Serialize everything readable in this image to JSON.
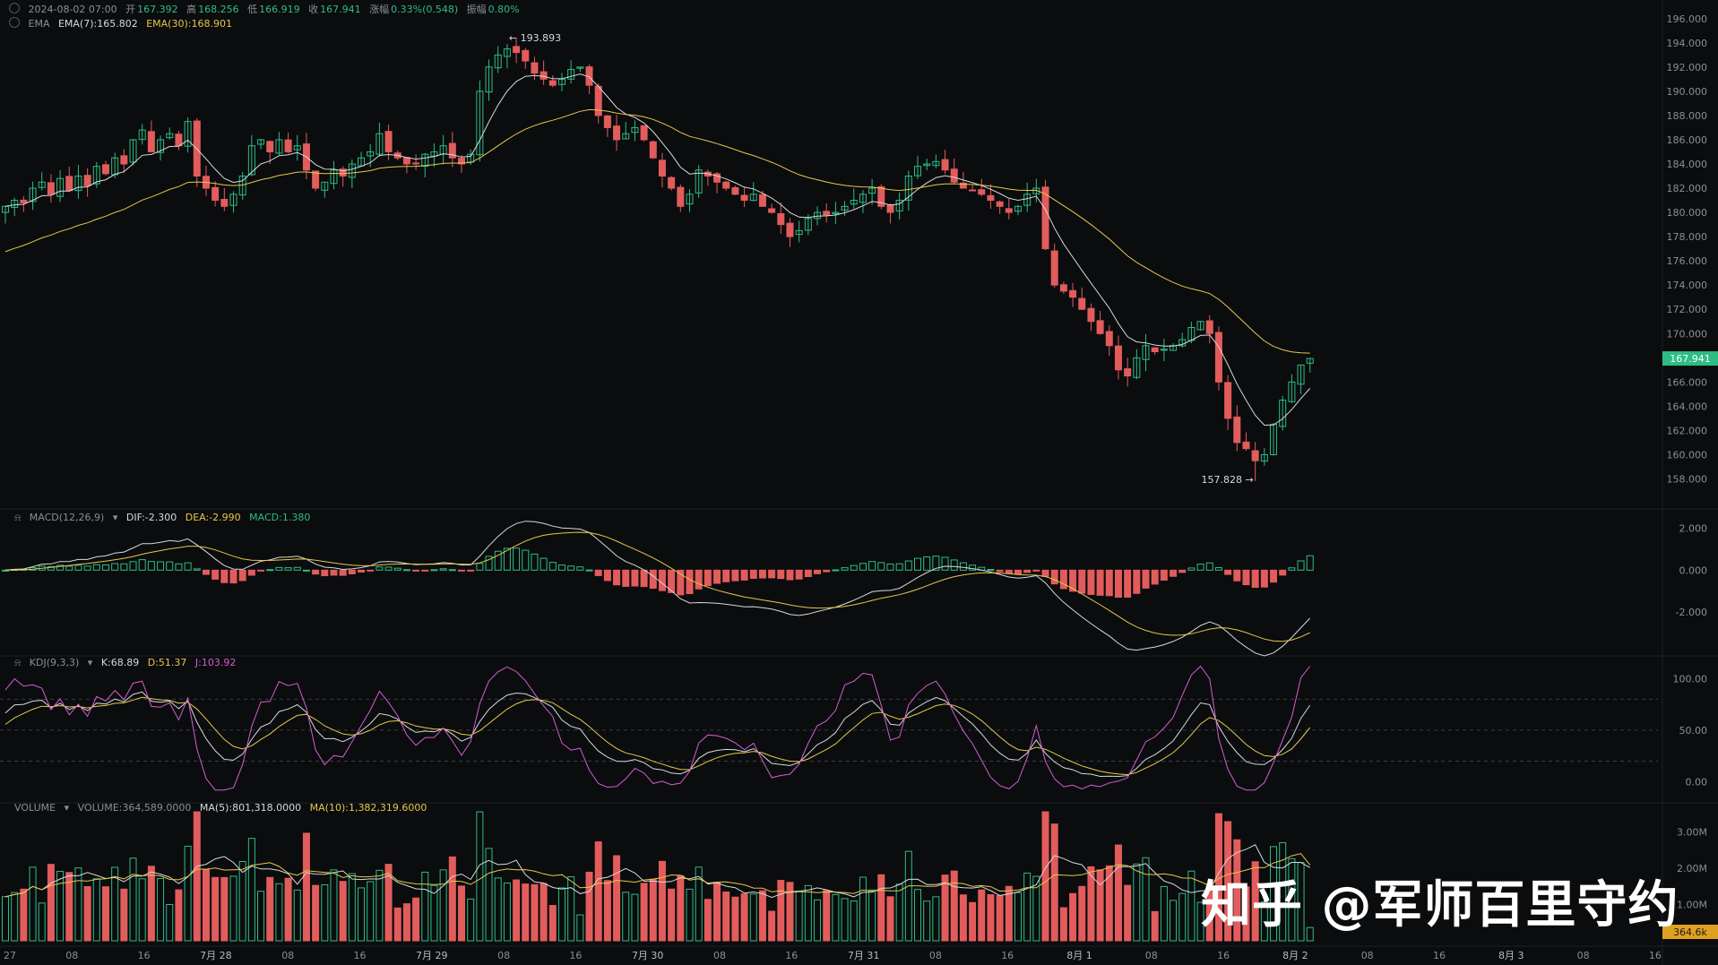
{
  "header": {
    "datetime": "2024-08-02 07:00",
    "open_label": "开",
    "open": "167.392",
    "high_label": "高",
    "high": "168.256",
    "low_label": "低",
    "low": "166.919",
    "close_label": "收",
    "close": "167.941",
    "change_label": "涨幅",
    "change": "0.33%(0.548)",
    "amp_label": "振幅",
    "amp": "0.80%"
  },
  "ema_row": {
    "name": "EMA",
    "ema7": "EMA(7):165.802",
    "ema30": "EMA(30):168.901"
  },
  "macd_row": {
    "name": "MACD(12,26,9)",
    "dif": "DIF:-2.300",
    "dea": "DEA:-2.990",
    "macd": "MACD:1.380"
  },
  "kdj_row": {
    "name": "KDJ(9,3,3)",
    "k": "K:68.89",
    "d": "D:51.37",
    "j": "J:103.92"
  },
  "vol_row": {
    "name": "VOLUME",
    "vol": "VOLUME:364,589.0000",
    "ma5": "MA(5):801,318.0000",
    "ma10": "MA(10):1,382,319.6000"
  },
  "watermark": "知乎 @军师百里守约",
  "colors": {
    "up": "#2dbd85",
    "down": "#e25c5c",
    "ema7": "#d7d9dc",
    "ema30": "#e6c84a",
    "kdj_j": "#d35ed1",
    "bg": "#0b0c0e"
  },
  "chart_data": [
    {
      "type": "candlestick",
      "title": "",
      "price_axis_ticks": [
        "196.000",
        "194.000",
        "192.000",
        "190.000",
        "188.000",
        "186.000",
        "184.000",
        "182.000",
        "180.000",
        "178.000",
        "176.000",
        "174.000",
        "172.000",
        "170.000",
        "168.000",
        "166.000",
        "164.000",
        "162.000",
        "160.000",
        "158.000"
      ],
      "ylim": [
        157,
        196.5
      ],
      "time_axis_labels": [
        "27",
        "08",
        "16",
        "7月 28",
        "08",
        "16",
        "7月 29",
        "08",
        "16",
        "7月 30",
        "08",
        "16",
        "7月 31",
        "08",
        "16",
        "8月 1",
        "08",
        "16",
        "8月 2",
        "08",
        "16",
        "8月 3",
        "08",
        "16"
      ],
      "last_price_label": "167.941",
      "annotations": {
        "high": "193.893",
        "low": "157.828"
      },
      "close_series": [
        180.5,
        181.0,
        180.8,
        182.0,
        182.5,
        181.5,
        182.8,
        181.8,
        183.0,
        182.2,
        183.8,
        183.2,
        184.5,
        184.0,
        186.0,
        186.8,
        185.0,
        186.0,
        186.5,
        185.5,
        187.5,
        183.0,
        182.0,
        181.0,
        180.5,
        181.5,
        183.0,
        185.5,
        186.0,
        185.0,
        186.0,
        185.0,
        185.5,
        183.5,
        182.0,
        182.5,
        183.5,
        183.0,
        184.0,
        184.5,
        185.0,
        186.5,
        185.0,
        184.5,
        184.0,
        184.0,
        184.8,
        185.0,
        185.5,
        184.5,
        184.0,
        184.8,
        190.0,
        192.0,
        193.0,
        193.5,
        193.2,
        192.5,
        191.5,
        191.0,
        190.5,
        191.0,
        191.8,
        192.0,
        190.5,
        188.0,
        187.0,
        186.0,
        186.5,
        187.0,
        186.0,
        184.5,
        183.0,
        182.0,
        180.5,
        181.5,
        183.5,
        183.0,
        182.5,
        182.0,
        181.5,
        181.0,
        181.5,
        180.5,
        180.0,
        179.0,
        178.0,
        178.5,
        179.5,
        180.0,
        179.8,
        180.0,
        180.5,
        181.0,
        181.5,
        182.0,
        180.5,
        180.0,
        181.0,
        183.0,
        183.8,
        184.0,
        184.2,
        183.5,
        182.5,
        182.0,
        181.8,
        181.5,
        181.0,
        180.5,
        180.0,
        180.5,
        181.5,
        182.0,
        177.0,
        174.0,
        173.5,
        173.0,
        172.0,
        171.0,
        170.0,
        169.0,
        167.0,
        166.5,
        168.0,
        169.0,
        168.5,
        168.7,
        169.0,
        169.5,
        170.5,
        171.0,
        170.0,
        166.0,
        163.0,
        161.0,
        160.5,
        159.5,
        160.0,
        162.5,
        164.5,
        166.0,
        167.4,
        167.94
      ],
      "ema_labels": [
        "EMA(7):165.802",
        "EMA(30):168.901"
      ]
    },
    {
      "type": "bar",
      "title": "MACD(12,26,9)",
      "y_ticks": [
        "2.000",
        "0.000",
        "-2.000"
      ],
      "ylim": [
        -3.5,
        2.5
      ],
      "series": [
        {
          "name": "DIF",
          "last": -2.3
        },
        {
          "name": "DEA",
          "last": -2.99
        },
        {
          "name": "MACD",
          "last": 1.38
        }
      ]
    },
    {
      "type": "line",
      "title": "KDJ(9,3,3)",
      "y_ticks": [
        "100.00",
        "50.00",
        "0.00"
      ],
      "ylim": [
        -10,
        115
      ],
      "series": [
        {
          "name": "K",
          "last": 68.89
        },
        {
          "name": "D",
          "last": 51.37
        },
        {
          "name": "J",
          "last": 103.92
        }
      ]
    },
    {
      "type": "bar",
      "title": "VOLUME",
      "y_ticks": [
        "3.00M",
        "2.00M",
        "1.00M"
      ],
      "ylim": [
        0,
        3.6
      ],
      "last_volume_label": "364.6k",
      "series": [
        {
          "name": "VOLUME",
          "last": 364589.0
        },
        {
          "name": "MA(5)",
          "last": 801318.0
        },
        {
          "name": "MA(10)",
          "last": 1382319.6
        }
      ]
    }
  ]
}
